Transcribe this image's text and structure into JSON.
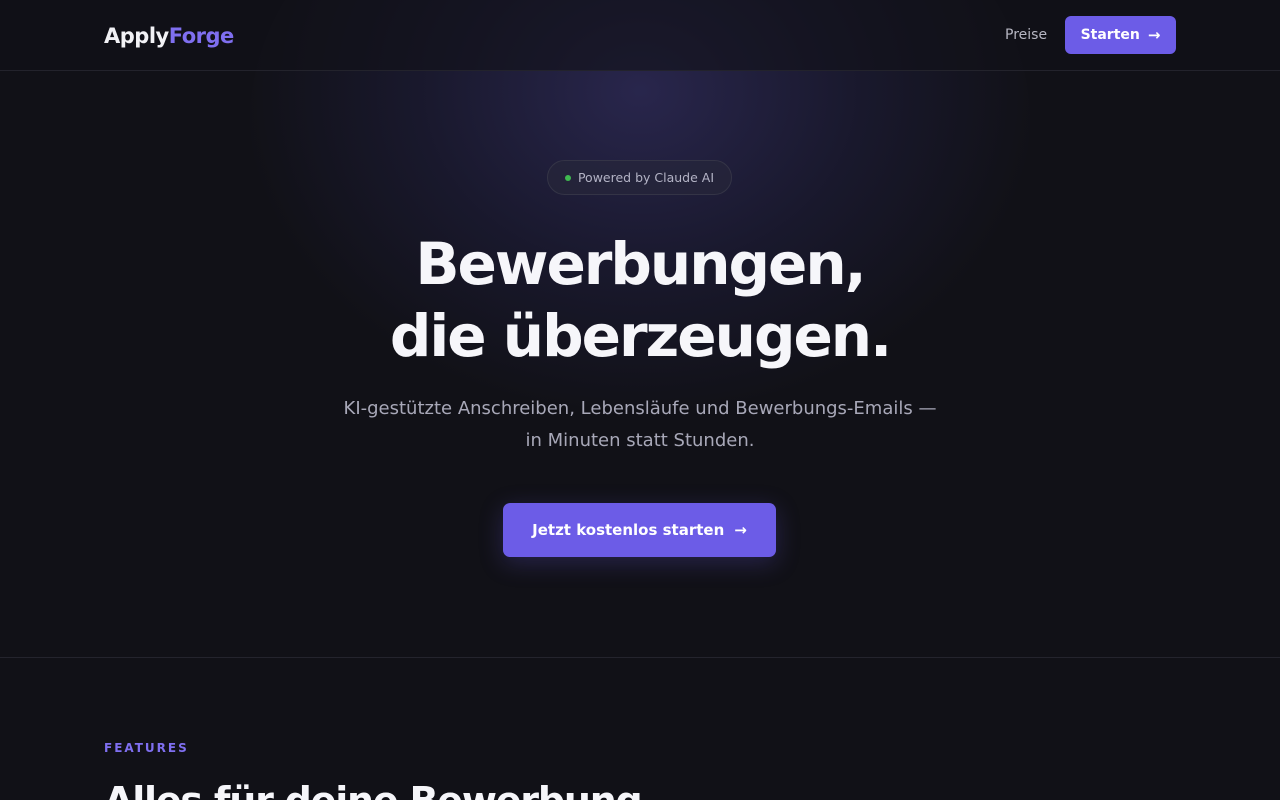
{
  "nav": {
    "logo_part1": "Apply",
    "logo_part2": "Forge",
    "pricing_link": "Preise",
    "cta_label": "Starten",
    "cta_icon": "arrow-right-icon"
  },
  "hero": {
    "badge_text": "Powered by Claude AI",
    "headline_line1": "Bewerbungen,",
    "headline_line2": "die überzeugen.",
    "subtitle": "KI-gestützte Anschreiben, Lebensläufe und Bewerbungs-Emails — in Minuten statt Stunden.",
    "cta_label": "Jetzt kostenlos starten",
    "cta_icon": "arrow-right-icon"
  },
  "features": {
    "eyebrow": "FEATURES",
    "title": "Alles für deine Bewerbung"
  },
  "colors": {
    "background": "#111117",
    "accent": "#6c5ce7",
    "accent_text": "#7f6ff0",
    "status_dot": "#3fb950"
  }
}
